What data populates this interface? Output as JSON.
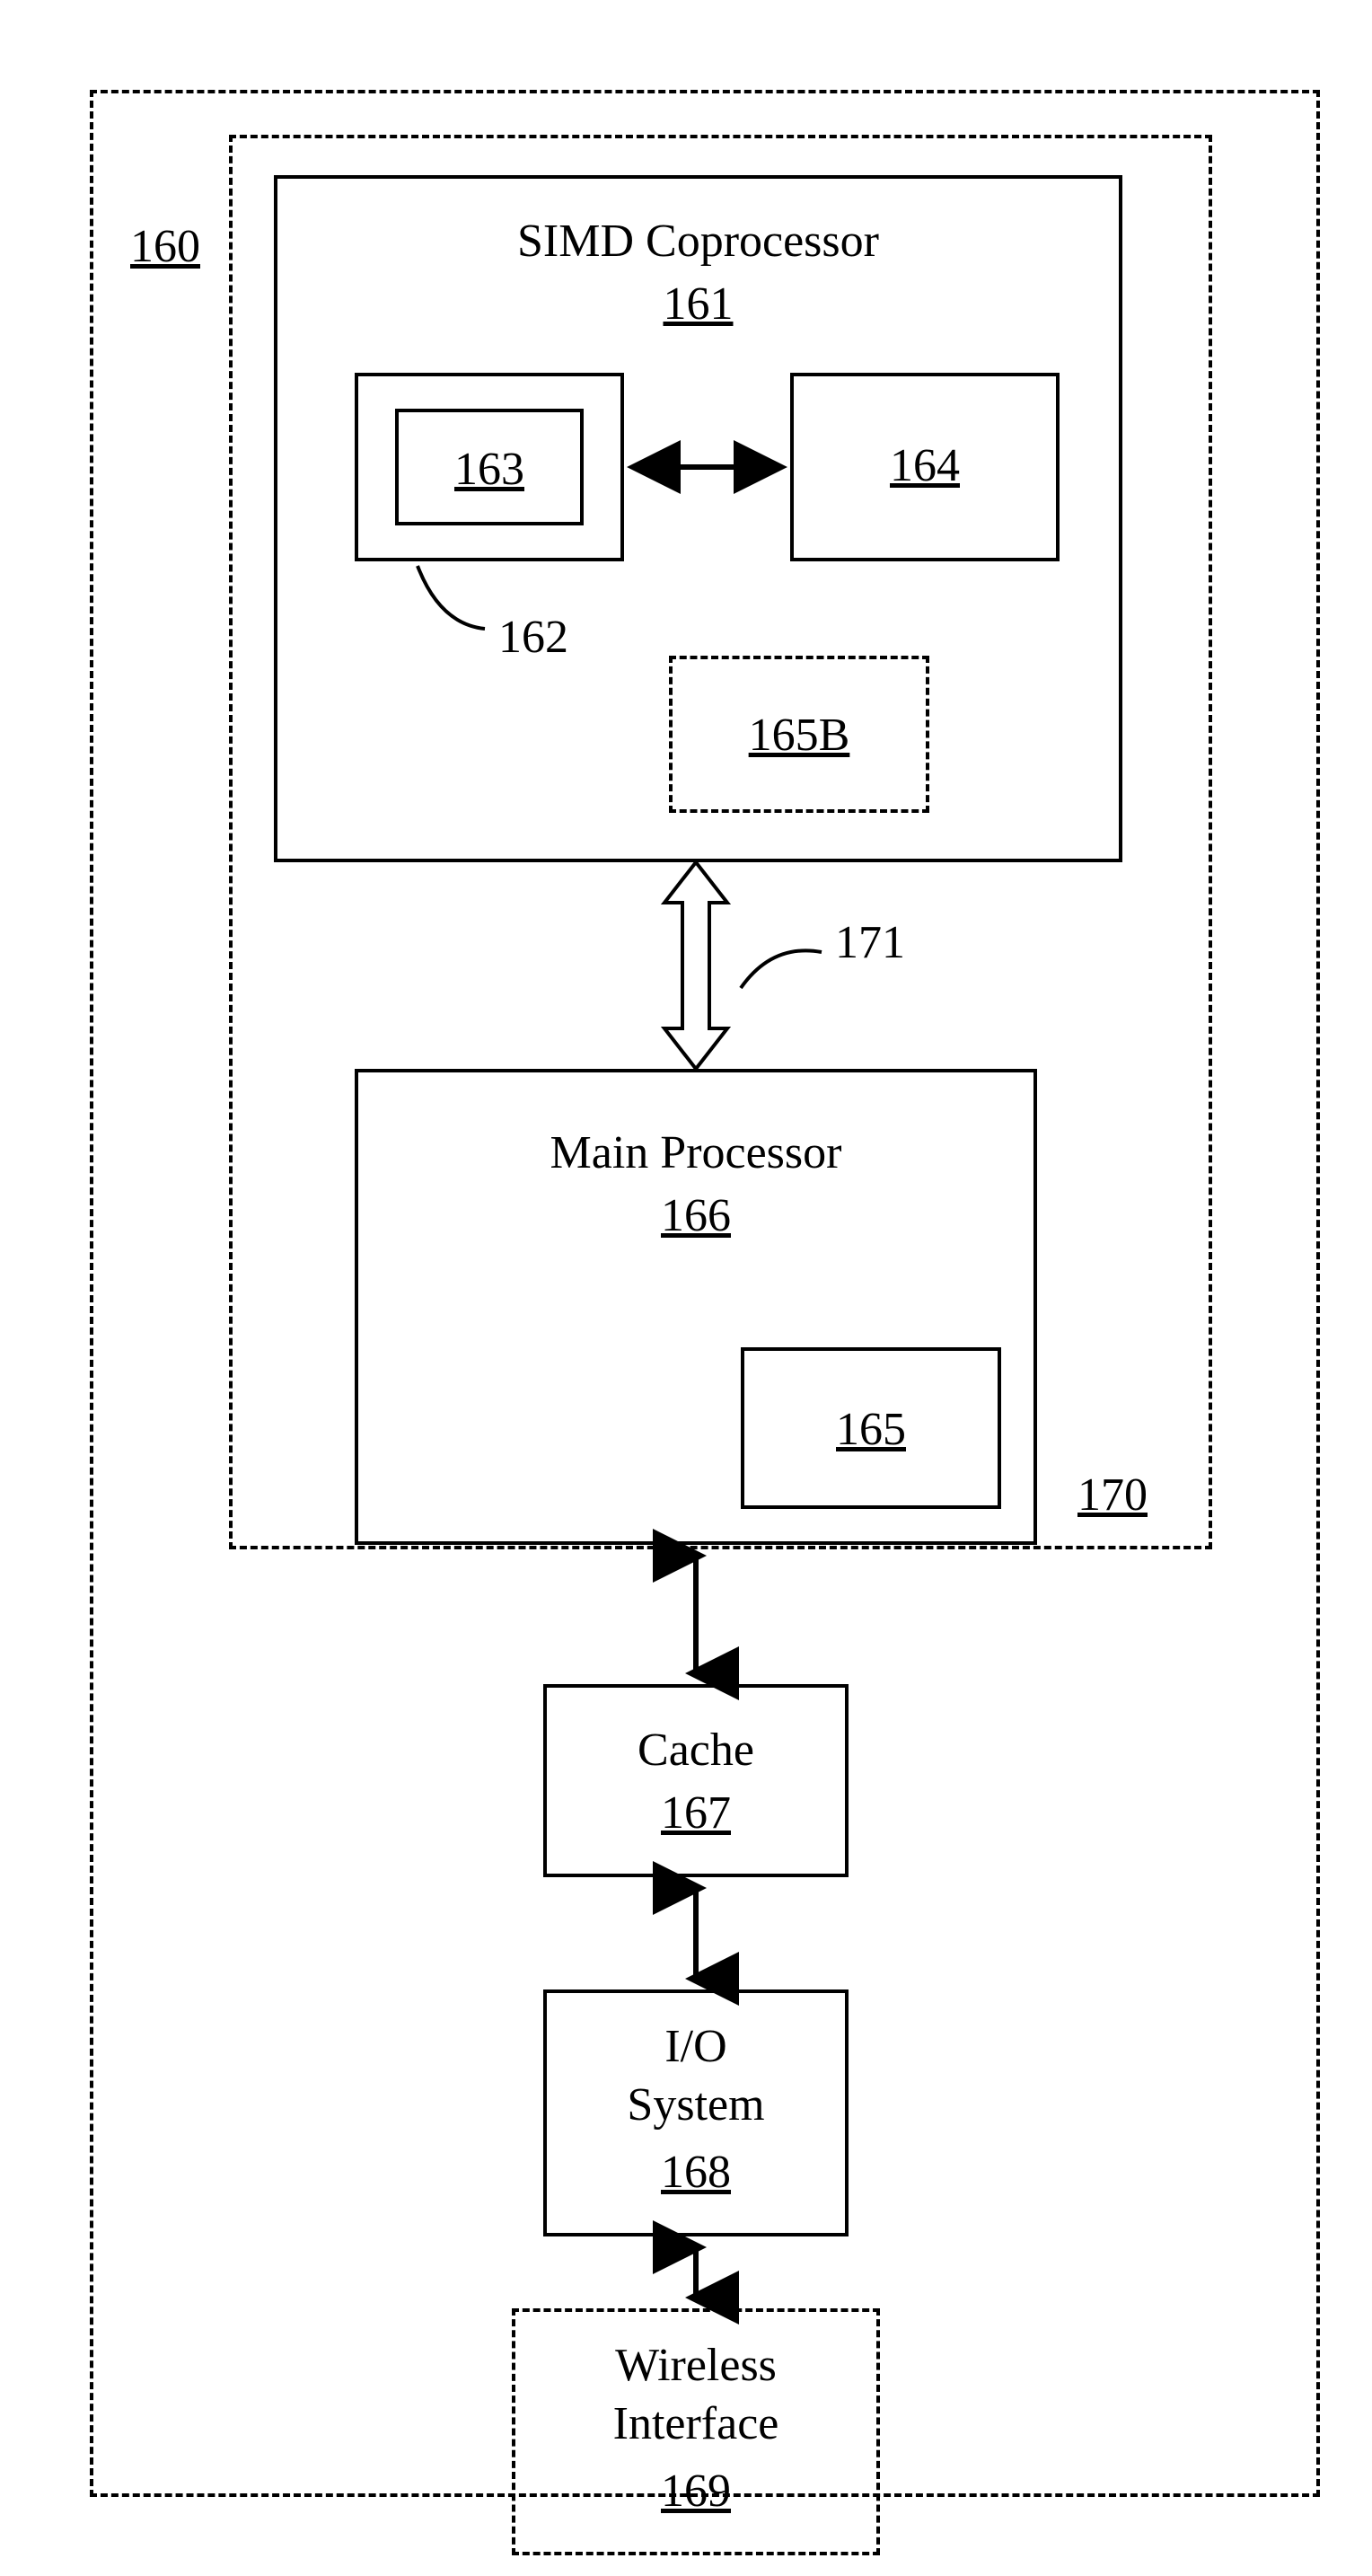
{
  "outer": {
    "ref": "160"
  },
  "core": {
    "ref": "170"
  },
  "simd": {
    "title": "SIMD Coprocessor",
    "ref": "161"
  },
  "exec": {
    "ref": "162"
  },
  "inner163": {
    "ref": "163"
  },
  "block164": {
    "ref": "164"
  },
  "optional165b": {
    "ref": "165B"
  },
  "bus": {
    "ref": "171"
  },
  "main": {
    "title": "Main Processor",
    "ref": "166"
  },
  "decoder165": {
    "ref": "165"
  },
  "cache": {
    "title": "Cache",
    "ref": "167"
  },
  "io": {
    "title1": "I/O",
    "title2": "System",
    "ref": "168"
  },
  "wireless": {
    "title1": "Wireless",
    "title2": "Interface",
    "ref": "169"
  }
}
